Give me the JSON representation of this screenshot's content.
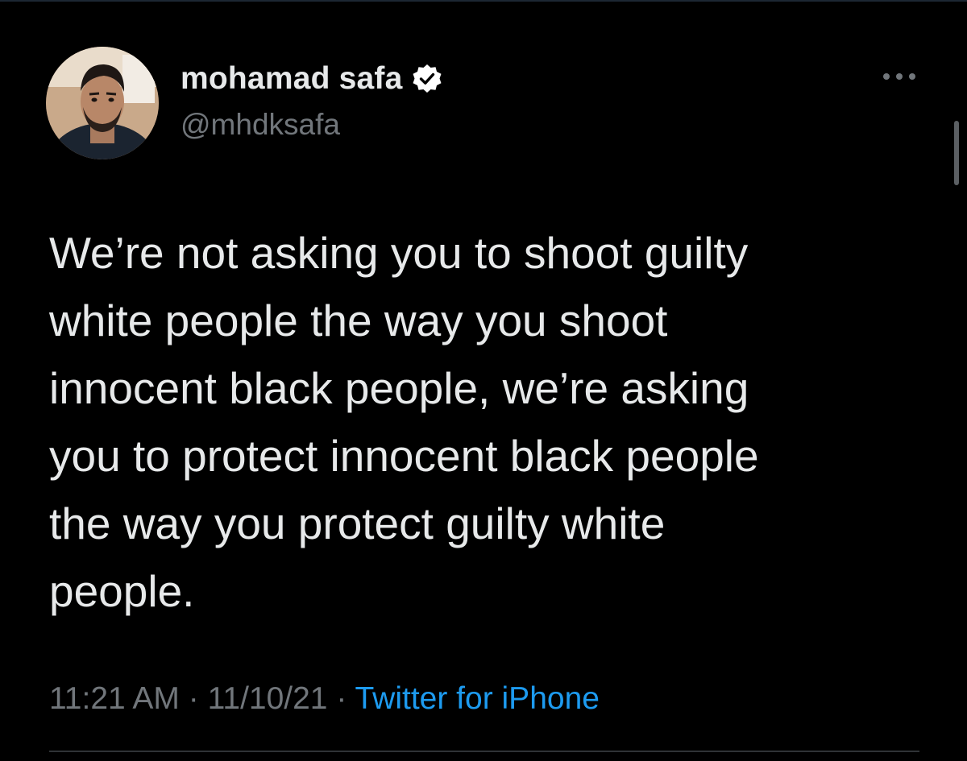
{
  "author": {
    "display_name": "mohamad safa",
    "handle": "@mhdksafa",
    "verified": true,
    "avatar_icon": "profile-photo"
  },
  "tweet": {
    "text": "We’re not asking you to shoot guilty\nwhite people the way you shoot\ninnocent black people, we’re asking\nyou to protect innocent black people\nthe way you protect guilty white\npeople.",
    "time": "11:21 AM",
    "separator": "·",
    "date": "11/10/21",
    "source": "Twitter for iPhone"
  },
  "icons": {
    "verified": "verified-badge-icon",
    "more": "more-options-icon"
  },
  "colors": {
    "background": "#000000",
    "primary_text": "#e7e9ea",
    "secondary_text": "#71767b",
    "link": "#1d9bf0",
    "divider": "#2f3336"
  }
}
